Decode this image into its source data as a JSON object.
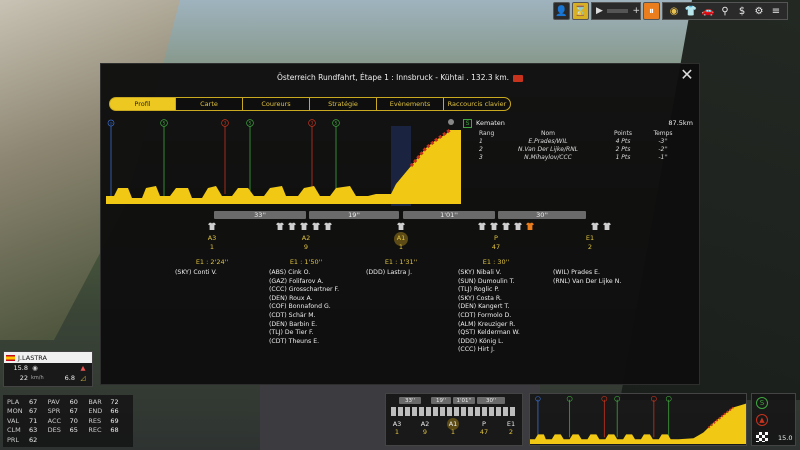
{
  "topbar": {
    "play_icon": "play-icon",
    "pause_icon": "pause-icon",
    "group_icons": [
      "eye-icon",
      "jersey-icon",
      "rider-icon",
      "car-icon",
      "money-icon",
      "bike-icon",
      "menu-icon"
    ]
  },
  "modal": {
    "title": "Österreich Rundfahrt, Étape 1 : Innsbruck - Kühtai . 132.3 km.",
    "close_label": "✕",
    "tabs": [
      "Profil",
      "Carte",
      "Coureurs",
      "Stratégie",
      "Evènements",
      "Raccourcis clavier"
    ]
  },
  "profile_markers": [
    "⊙",
    "S",
    "3",
    "S",
    "3",
    "S"
  ],
  "classification": {
    "sprint_icon": "S",
    "location": "Kematen",
    "km": "87.5km",
    "headers": {
      "rang": "Rang",
      "nom": "Nom",
      "points": "Points",
      "temps": "Temps"
    },
    "rows": [
      {
        "rang": "1",
        "nom": "E.Prades/WIL",
        "points": "4 Pts",
        "temps": "-3''"
      },
      {
        "rang": "2",
        "nom": "N.Van Der Lijke/RNL",
        "points": "2 Pts",
        "temps": "-2''"
      },
      {
        "rang": "3",
        "nom": "N.Mihaylov/CCC",
        "points": "1 Pts",
        "temps": "-1''"
      }
    ]
  },
  "gaps": [
    "33''",
    "19''",
    "1'01''",
    "30''"
  ],
  "groups": [
    {
      "code": "A3",
      "count": "1",
      "time": "E1 : 2'24''",
      "riders": [
        "(SKY) Conti V."
      ]
    },
    {
      "code": "A2",
      "count": "9",
      "time": "E1 : 1'50''",
      "riders": [
        "(ABS) Cink O.",
        "(GAZ) Folifarov A.",
        "(CCC) Grosschartner F.",
        "(DEN) Roux A.",
        "(COF) Bonnafond G.",
        "(CDT) Schär M.",
        "(DEN) Barbin E.",
        "(TLJ) De Tier F.",
        "(CDT) Theuns E."
      ]
    },
    {
      "code": "A1",
      "count": "1",
      "time": "E1 : 1'31''",
      "riders": [
        "(DDD) Lastra J."
      ]
    },
    {
      "code": "P",
      "count": "47",
      "time": "E1 : 30''",
      "riders": [
        "(SKY) Nibali V.",
        "(SUN) Dumoulin T.",
        "(TLJ) Roglic P.",
        "(SKY) Costa R.",
        "(DEN) Kangert T.",
        "(CDT) Formolo D.",
        "(ALM) Kreuziger R.",
        "(QST) Kelderman W.",
        "(DDD) König L.",
        "(CCC) Hirt J."
      ]
    },
    {
      "code": "E1",
      "count": "2",
      "time": "",
      "riders": [
        "(WIL) Prades E.",
        "(RNL) Van Der Lijke N."
      ]
    }
  ],
  "rider_card": {
    "name": "J.LASTRA",
    "speed": "15.8",
    "speed_unit": "",
    "kmh": "22",
    "kmh_unit": "km/h",
    "slope": "6.8",
    "energy_icon": "▲",
    "slope_icon": "◿",
    "heart_icon": "◉"
  },
  "stats": [
    {
      "k": "PLA",
      "v": "67"
    },
    {
      "k": "PAV",
      "v": "60"
    },
    {
      "k": "BAR",
      "v": "72"
    },
    {
      "k": "MON",
      "v": "67"
    },
    {
      "k": "SPR",
      "v": "67"
    },
    {
      "k": "END",
      "v": "66"
    },
    {
      "k": "VAL",
      "v": "71"
    },
    {
      "k": "ACC",
      "v": "70"
    },
    {
      "k": "RES",
      "v": "69"
    },
    {
      "k": "CLM",
      "v": "63"
    },
    {
      "k": "DES",
      "v": "65"
    },
    {
      "k": "REC",
      "v": "68"
    },
    {
      "k": "PRL",
      "v": "62"
    }
  ],
  "mini_groups": {
    "gaps": [
      "33''",
      "19''",
      "1'01''",
      "30''"
    ],
    "codes": [
      "A3",
      "A2",
      "A1",
      "P",
      "E1"
    ],
    "counts": [
      "1",
      "9",
      "1",
      "47",
      "2"
    ]
  },
  "mini_right": {
    "sprint": "S",
    "climb": "▲",
    "dist": "15.0"
  },
  "colors": {
    "accent": "#ecc821",
    "sprint": "#3fa53f",
    "climb": "#c8331e",
    "profile": "#f1c814"
  }
}
